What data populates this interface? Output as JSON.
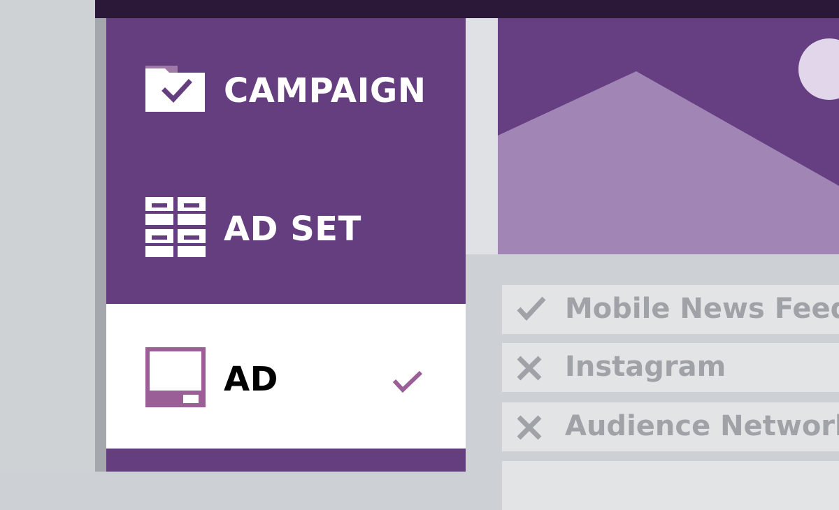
{
  "nav": {
    "items": [
      {
        "label": "CAMPAIGN",
        "icon": "folder-check-icon",
        "selected": false
      },
      {
        "label": "AD SET",
        "icon": "grid-icon",
        "selected": false
      },
      {
        "label": "AD",
        "icon": "ad-frame-icon",
        "selected": true,
        "status_icon": "checkmark-icon"
      }
    ]
  },
  "placements": [
    {
      "label": "Mobile News Feed",
      "state": "included",
      "icon": "checkmark-icon"
    },
    {
      "label": "Instagram",
      "state": "excluded",
      "icon": "x-icon"
    },
    {
      "label": "Audience Network",
      "state": "excluded",
      "icon": "x-icon"
    }
  ],
  "preview": {
    "icon": "image-placeholder-icon"
  },
  "colors": {
    "brand_purple": "#653e80",
    "dark_bar": "#2b1838",
    "mountain": "#a085b5",
    "sun": "#e2d6ea",
    "check_purple": "#9a5f96",
    "placement_text": "#9fa2a6"
  }
}
